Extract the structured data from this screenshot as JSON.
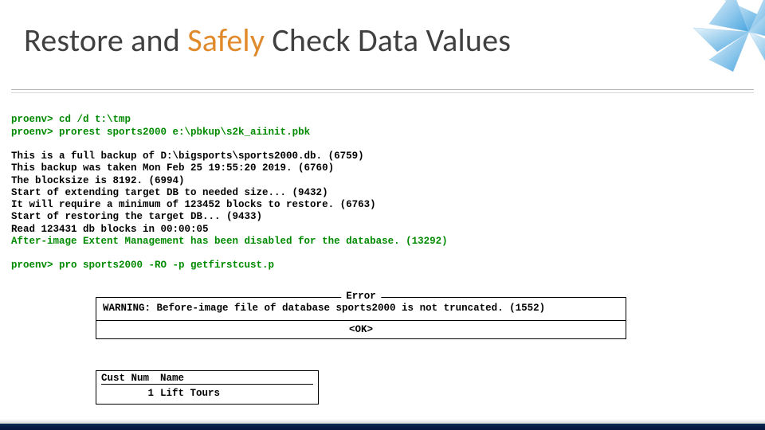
{
  "title": {
    "pre": "Restore and ",
    "accent": "Safely",
    "post": " Check Data Values"
  },
  "console": {
    "p1": "proenv>",
    "cmd1": " cd /d t:\\tmp",
    "p2": "proenv>",
    "cmd2": " prorest sports2000 e:\\pbkup\\s2k_aiinit.pbk",
    "l1": "This is a full backup of D:\\bigsports\\sports2000.db. (6759)",
    "l2": "This backup was taken Mon Feb 25 19:55:20 2019. (6760)",
    "l3": "The blocksize is 8192. (6994)",
    "l4": "Start of extending target DB to needed size... (9432)",
    "l5": "It will require a minimum of 123452 blocks to restore. (6763)",
    "l6": "Start of restoring the target DB... (9433)",
    "l7": "Read 123431 db blocks in 00:00:05",
    "l8": "After-image Extent Management has been disabled for the database. (13292)",
    "p3": "proenv>",
    "cmd3": " pro sports2000 -RO -p getfirstcust.p"
  },
  "error": {
    "title": "Error",
    "body": "WARNING: Before-image file of database sports2000 is not truncated. (1552)",
    "ok": "<OK>"
  },
  "table": {
    "h1": "Cust Num",
    "h2": "Name",
    "r1c1": "1",
    "r1c2": "Lift Tours"
  }
}
